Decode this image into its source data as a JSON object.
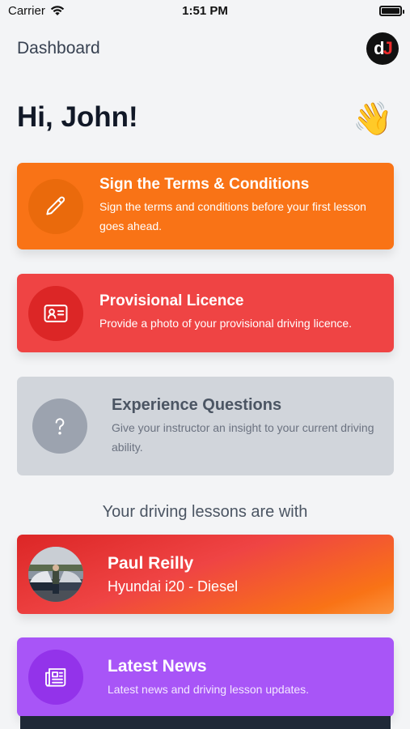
{
  "status_bar": {
    "carrier": "Carrier",
    "time": "1:51 PM"
  },
  "header": {
    "title": "Dashboard",
    "logo_left": "d",
    "logo_right": "J"
  },
  "greeting": "Hi, John!",
  "wave_emoji": "👋",
  "cards": {
    "terms": {
      "title": "Sign the Terms & Conditions",
      "subtitle": "Sign the terms and conditions before your first lesson goes ahead.",
      "icon": "pencil-icon",
      "color": "#f97316"
    },
    "licence": {
      "title": "Provisional Licence",
      "subtitle": "Provide a photo of your provisional driving licence.",
      "icon": "id-card-icon",
      "color": "#ef4444"
    },
    "experience": {
      "title": "Experience Questions",
      "subtitle": "Give your instructor an insight to your current driving ability.",
      "icon": "question-icon",
      "color": "#d1d5db"
    }
  },
  "section_label": "Your driving lessons are with",
  "instructor": {
    "name": "Paul Reilly",
    "car": "Hyundai i20 - Diesel"
  },
  "news": {
    "title": "Latest News",
    "subtitle": "Latest news and driving lesson updates.",
    "icon": "newspaper-icon",
    "color": "#a855f7"
  }
}
